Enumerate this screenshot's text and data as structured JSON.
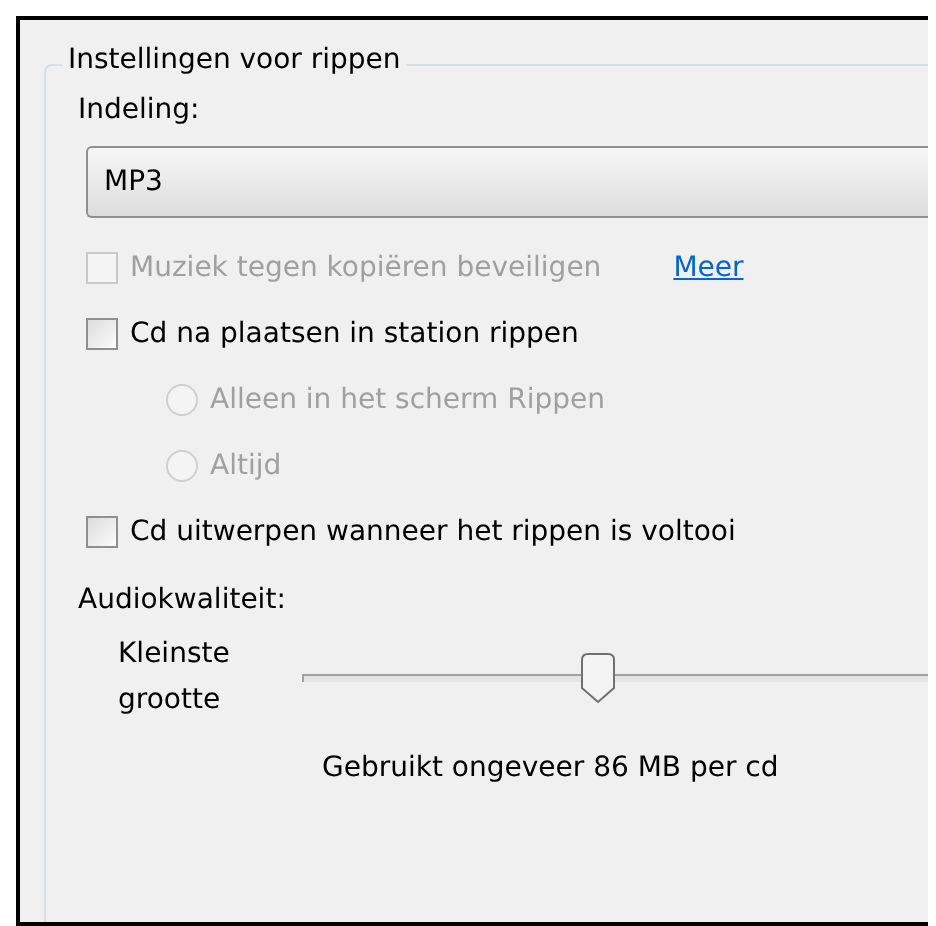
{
  "group": {
    "title": "Instellingen voor rippen"
  },
  "format": {
    "label": "Indeling:",
    "value": "MP3"
  },
  "options": [
    {
      "kind": "checkbox",
      "label": "Muziek tegen kopiëren beveiligen",
      "checked": false,
      "disabled": true,
      "link": "Meer"
    },
    {
      "kind": "checkbox",
      "label": "Cd na plaatsen in station rippen",
      "checked": false,
      "disabled": false
    },
    {
      "kind": "radio",
      "label": "Alleen in het scherm Rippen",
      "selected": false,
      "disabled": true
    },
    {
      "kind": "radio",
      "label": "Altijd",
      "selected": false,
      "disabled": true
    },
    {
      "kind": "checkbox",
      "label": "Cd uitwerpen wanneer het rippen is voltooi",
      "checked": false,
      "disabled": false
    }
  ],
  "quality": {
    "label": "Audiokwaliteit:",
    "min_label": "Kleinste grootte",
    "level": 0.47,
    "note": "Gebruikt ongeveer 86 MB per cd"
  }
}
